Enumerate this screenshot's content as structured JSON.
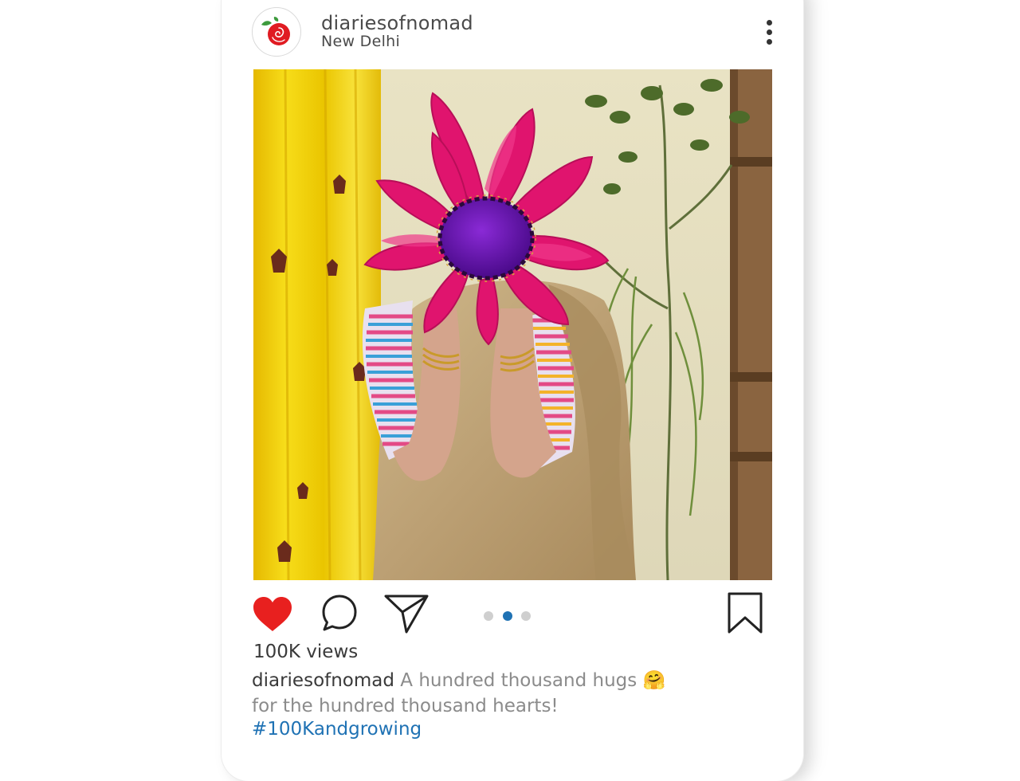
{
  "post": {
    "username": "diariesofnomad",
    "location": "New Delhi",
    "views": "100K views",
    "caption": {
      "username": "diariesofnomad",
      "line1": "A hundred thousand hugs",
      "emoji": "🤗",
      "line2": "for the hundred thousand hearts!"
    },
    "hashtag": "#100Kandgrowing",
    "carousel": {
      "total": 3,
      "active": 2
    },
    "liked": true
  },
  "icons": {
    "avatar": "rose-logo-icon",
    "more": "more-vertical-icon",
    "like": "heart-icon",
    "comment": "comment-bubble-icon",
    "share": "send-icon",
    "save": "bookmark-icon"
  },
  "colors": {
    "like_red": "#e8201f",
    "active_dot": "#1f72b4",
    "inactive_dot": "#cfcfcf",
    "hashtag_blue": "#1f72b4"
  }
}
